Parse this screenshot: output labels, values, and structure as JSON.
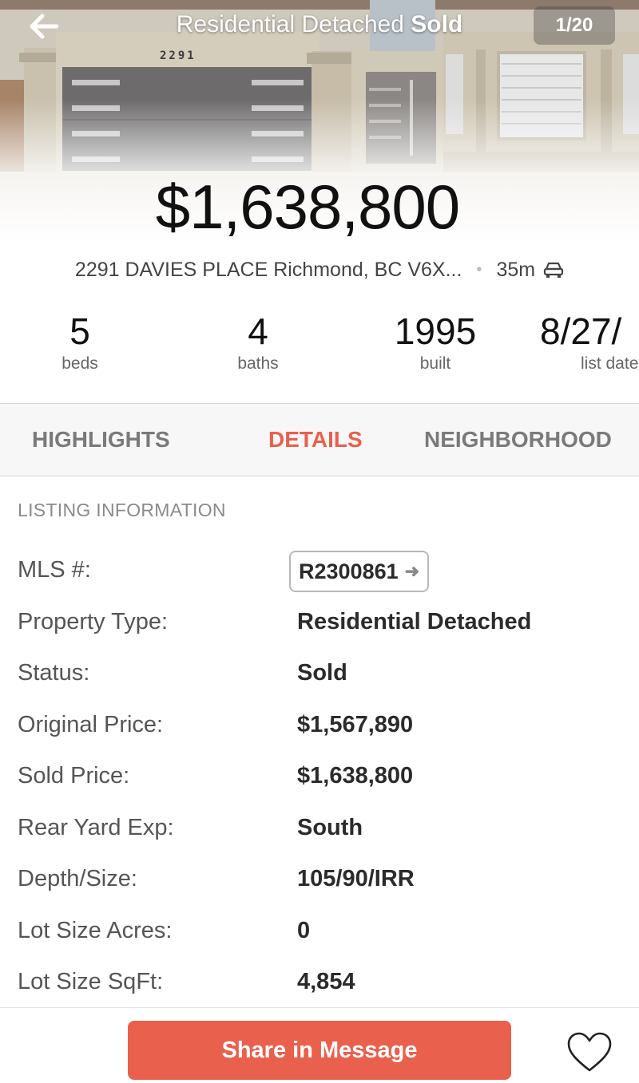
{
  "header": {
    "title": "Residential Detached",
    "status": "Sold",
    "photo_counter": "1/20",
    "price": "$1,638,800",
    "house_number_plate": "2291"
  },
  "location": {
    "address": "2291 DAVIES PLACE Richmond, BC V6X...",
    "separator": "•",
    "drive_time": "35m",
    "drive_icon": "car-icon"
  },
  "stats": [
    {
      "value": "5",
      "label": "beds"
    },
    {
      "value": "4",
      "label": "baths"
    },
    {
      "value": "1995",
      "label": "built"
    },
    {
      "value": "8/27/",
      "label": "list date"
    }
  ],
  "tabs": [
    {
      "label": "HIGHLIGHTS",
      "active": false
    },
    {
      "label": "DETAILS",
      "active": true
    },
    {
      "label": "NEIGHBORHOOD",
      "active": false
    }
  ],
  "listing": {
    "section_title": "LISTING INFORMATION",
    "mls_label": "MLS #:",
    "mls_value": "R2300861",
    "rows": [
      {
        "label": "Property Type:",
        "value": "Residential Detached"
      },
      {
        "label": "Status:",
        "value": "Sold"
      },
      {
        "label": "Original Price:",
        "value": "$1,567,890"
      },
      {
        "label": "Sold Price:",
        "value": "$1,638,800"
      },
      {
        "label": "Rear Yard Exp:",
        "value": "South"
      },
      {
        "label": "Depth/Size:",
        "value": "105/90/IRR"
      },
      {
        "label": "Lot Size Acres:",
        "value": "0"
      },
      {
        "label": "Lot Size SqFt:",
        "value": "4,854"
      }
    ]
  },
  "actions": {
    "share_label": "Share in Message",
    "favorite_icon": "heart-icon"
  },
  "colors": {
    "accent": "#e9604c",
    "active_tab": "#e8604c"
  }
}
